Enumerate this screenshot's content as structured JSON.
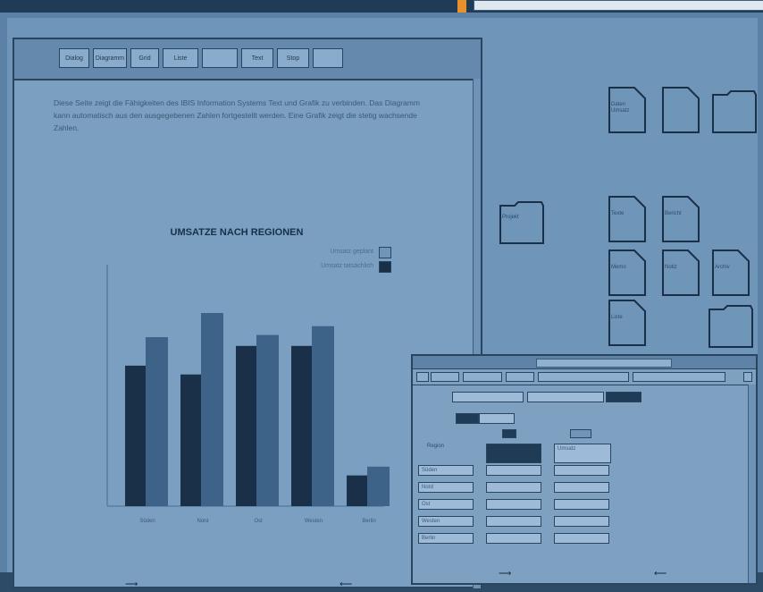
{
  "toolbar": {
    "buttons": [
      "Dialog",
      "Diagramm",
      "Grid",
      "Liste",
      "",
      "Text",
      "Stop",
      ""
    ]
  },
  "document": {
    "paragraph": "Diese Seite zeigt die Fähigkeiten des IBIS Information Systems Text und Grafik zu verbinden. Das Diagramm kann automatisch aus den ausgegebenen Zahlen fortgestellt werden. Eine Grafik zeigt die stetig wachsende Zahlen."
  },
  "chart_data": {
    "type": "bar",
    "title": "UMSATZE NACH REGIONEN",
    "categories": [
      "Süden",
      "Nord",
      "Ost",
      "Westen",
      "Berlin"
    ],
    "series": [
      {
        "name": "Umsatz geplant",
        "values": [
          64,
          60,
          73,
          73,
          14
        ]
      },
      {
        "name": "Umsatz tatsächlich",
        "values": [
          77,
          88,
          78,
          82,
          18
        ]
      }
    ],
    "ylim": [
      0,
      110
    ],
    "legend": "top-right",
    "colors": {
      "series1": "#1a2f48",
      "series2": "#3d6389"
    }
  },
  "desktop_icons": [
    {
      "name": "Daten Umsatz",
      "kind": "doc"
    },
    {
      "name": "",
      "kind": "doc"
    },
    {
      "name": "",
      "kind": "folder"
    },
    {
      "name": "Projekt",
      "kind": "folder"
    },
    {
      "name": "Texte",
      "kind": "doc"
    },
    {
      "name": "Bericht",
      "kind": "doc"
    },
    {
      "name": "Memo",
      "kind": "doc"
    },
    {
      "name": "Notiz",
      "kind": "doc"
    },
    {
      "name": "Liste",
      "kind": "doc"
    },
    {
      "name": "Archiv",
      "kind": "doc"
    },
    {
      "name": "",
      "kind": "folder"
    }
  ],
  "dialog": {
    "label_left": "Region",
    "col_header": "Umsatz",
    "rows": [
      "Süden",
      "Nord",
      "Ost",
      "Westen",
      "Berlin"
    ]
  }
}
